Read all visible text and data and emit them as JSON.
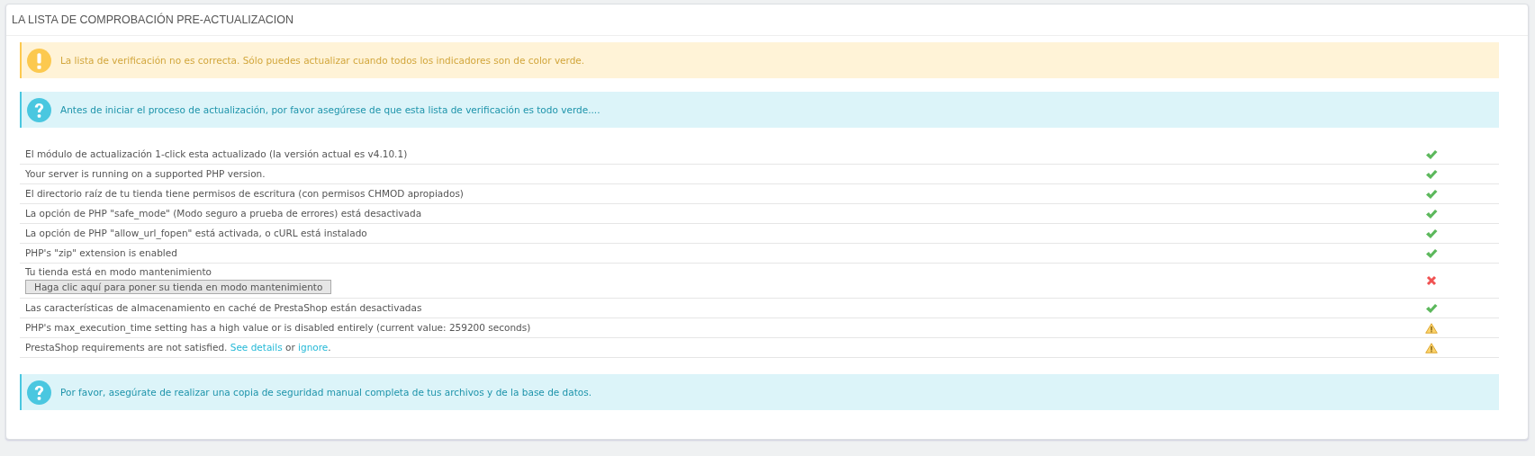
{
  "panel": {
    "title": "LA LISTA DE COMPROBACIÓN PRE-ACTUALIZACION"
  },
  "alerts_top": [
    {
      "kind": "warning",
      "text": "La lista de verificación no es correcta. Sólo puedes actualizar cuando todos los indicadores son de color verde."
    },
    {
      "kind": "info",
      "text": "Antes de iniciar el proceso de actualización, por favor asegúrese de que esta lista de verificación es todo verde...."
    }
  ],
  "checks": [
    {
      "segments": [
        {
          "kind": "text",
          "text": "El módulo de actualización 1-click esta actualizado (la versión actual es v4.10.1)"
        }
      ],
      "kind": "ok"
    },
    {
      "segments": [
        {
          "kind": "text",
          "text": "Your server is running on a supported PHP version."
        }
      ],
      "kind": "ok"
    },
    {
      "segments": [
        {
          "kind": "text",
          "text": "El directorio raíz de tu tienda tiene permisos de escritura (con permisos CHMOD apropiados)"
        }
      ],
      "kind": "ok"
    },
    {
      "segments": [
        {
          "kind": "text",
          "text": "La opción de PHP \"safe_mode\" (Modo seguro a prueba de errores) está desactivada"
        }
      ],
      "kind": "ok"
    },
    {
      "segments": [
        {
          "kind": "text",
          "text": "La opción de PHP \"allow_url_fopen\" está activada, o cURL está instalado"
        }
      ],
      "kind": "ok"
    },
    {
      "segments": [
        {
          "kind": "text",
          "text": "PHP's \"zip\" extension is enabled"
        }
      ],
      "kind": "ok"
    },
    {
      "segments": [
        {
          "kind": "text",
          "text": "Tu tienda está en modo mantenimiento"
        }
      ],
      "button": "Haga clic aquí para poner su tienda en modo mantenimiento",
      "kind": "error"
    },
    {
      "segments": [
        {
          "kind": "text",
          "text": "Las características de almacenamiento en caché de PrestaShop están desactivadas"
        }
      ],
      "kind": "ok"
    },
    {
      "segments": [
        {
          "kind": "text",
          "text": "PHP's max_execution_time setting has a high value or is disabled entirely (current value: 259200 seconds)"
        }
      ],
      "kind": "warning"
    },
    {
      "segments": [
        {
          "kind": "text",
          "text": "PrestaShop requirements are not satisfied. "
        },
        {
          "kind": "link",
          "text": "See details"
        },
        {
          "kind": "text",
          "text": " or "
        },
        {
          "kind": "link",
          "text": "ignore"
        },
        {
          "kind": "text",
          "text": "."
        }
      ],
      "kind": "warning"
    }
  ],
  "alerts_bottom": [
    {
      "kind": "info",
      "text": "Por favor, asegúrate de realizar una copia de seguridad manual completa de tus archivos y de la base de datos."
    }
  ]
}
